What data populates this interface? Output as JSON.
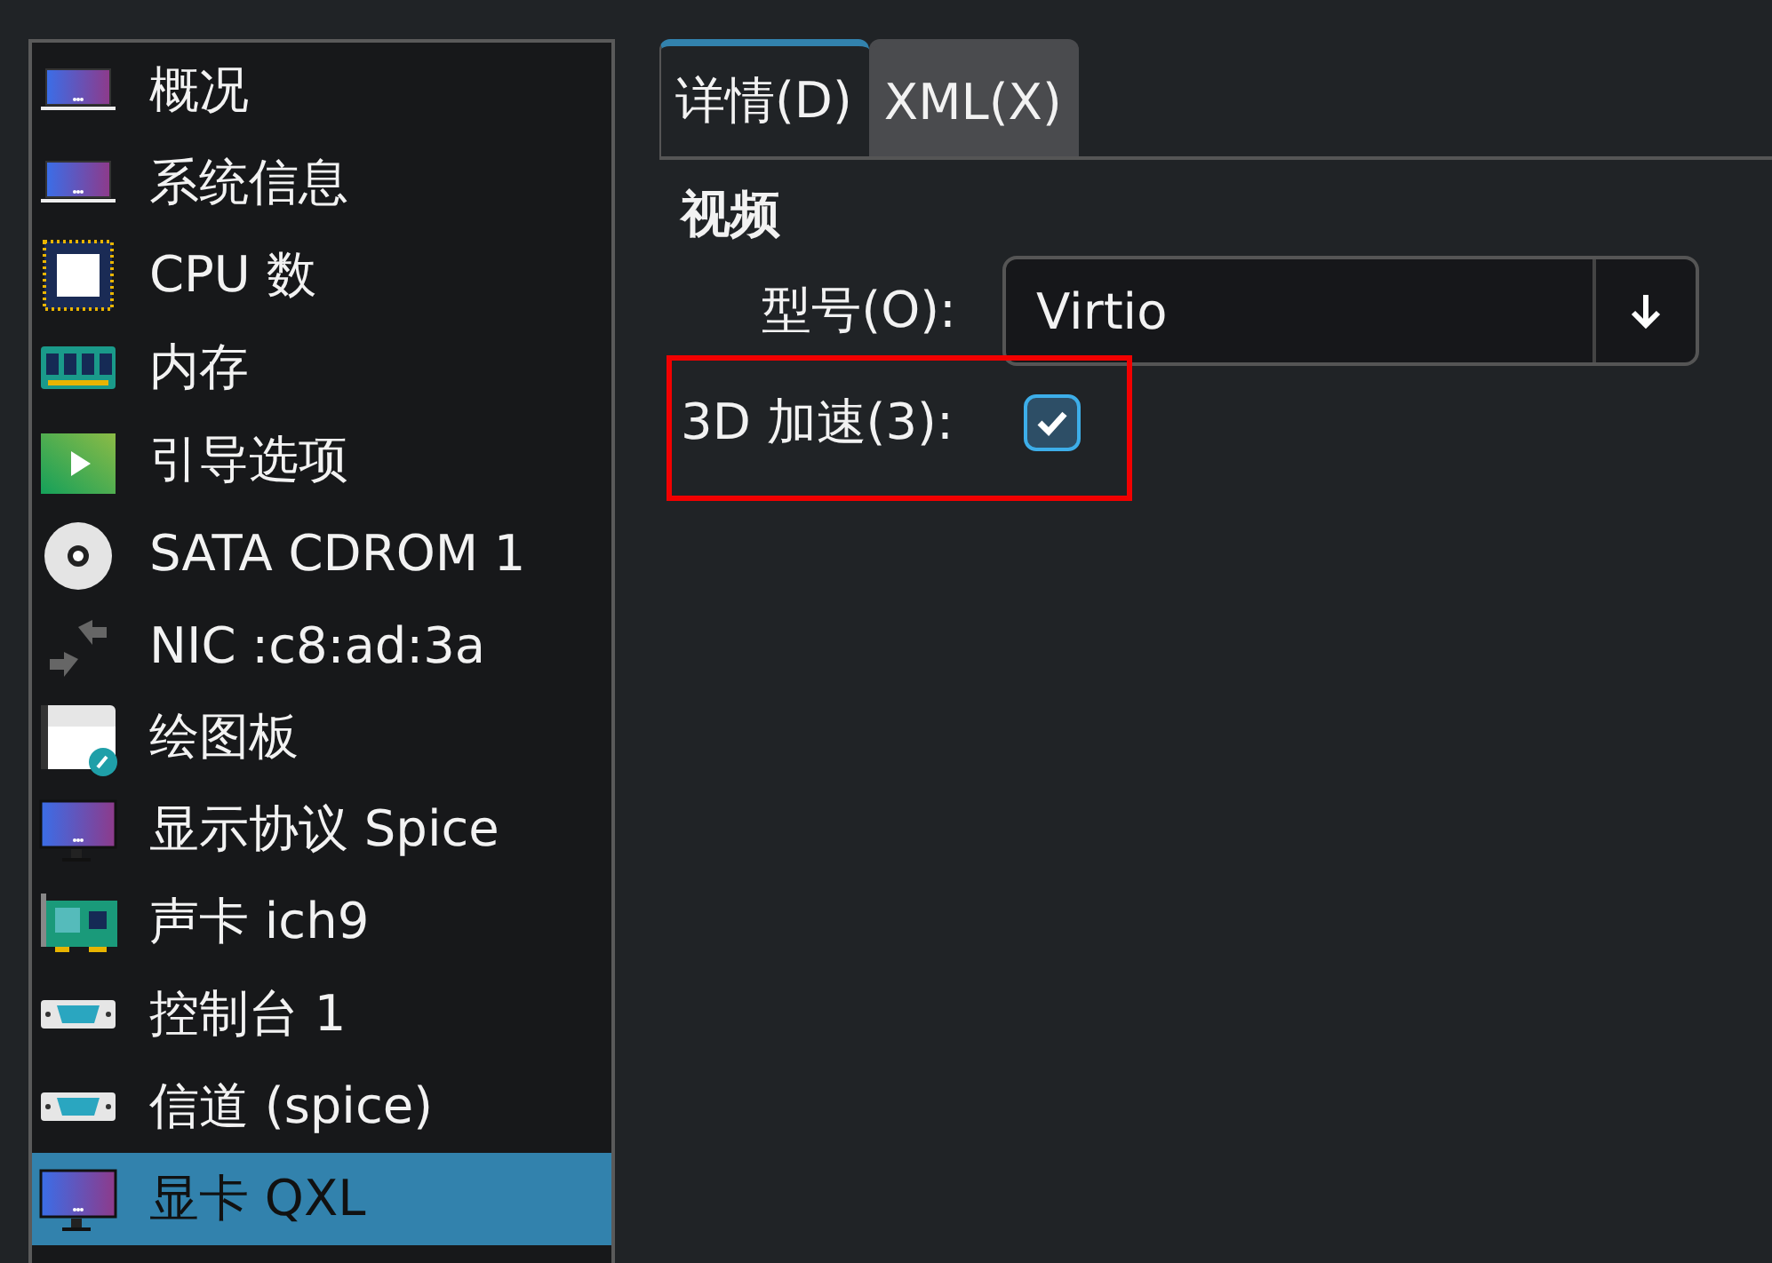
{
  "sidebar": {
    "items": [
      {
        "label": "概况",
        "kind": "laptop",
        "selected": false
      },
      {
        "label": "系统信息",
        "kind": "laptop",
        "selected": false
      },
      {
        "label": "CPU 数",
        "kind": "cpu",
        "selected": false
      },
      {
        "label": "内存",
        "kind": "memory",
        "selected": false
      },
      {
        "label": "引导选项",
        "kind": "play",
        "selected": false
      },
      {
        "label": "SATA CDROM 1",
        "kind": "disc",
        "selected": false
      },
      {
        "label": "NIC :c8:ad:3a",
        "kind": "network",
        "selected": false
      },
      {
        "label": "绘图板",
        "kind": "tablet",
        "selected": false
      },
      {
        "label": "显示协议 Spice",
        "kind": "monitor",
        "selected": false
      },
      {
        "label": "声卡 ich9",
        "kind": "soundcard",
        "selected": false
      },
      {
        "label": "控制台 1",
        "kind": "serial",
        "selected": false
      },
      {
        "label": "信道 (spice)",
        "kind": "serial",
        "selected": false
      },
      {
        "label": "显卡 QXL",
        "kind": "monitor",
        "selected": true
      }
    ]
  },
  "tabs": [
    {
      "label": "详情(D)",
      "selected": true
    },
    {
      "label": "XML(X)",
      "selected": false
    }
  ],
  "section": {
    "title": "视频",
    "model": {
      "label": "型号(O):",
      "value": "Virtio"
    },
    "accel": {
      "label": "3D 加速(3):",
      "checked": true,
      "highlighted": true
    }
  }
}
